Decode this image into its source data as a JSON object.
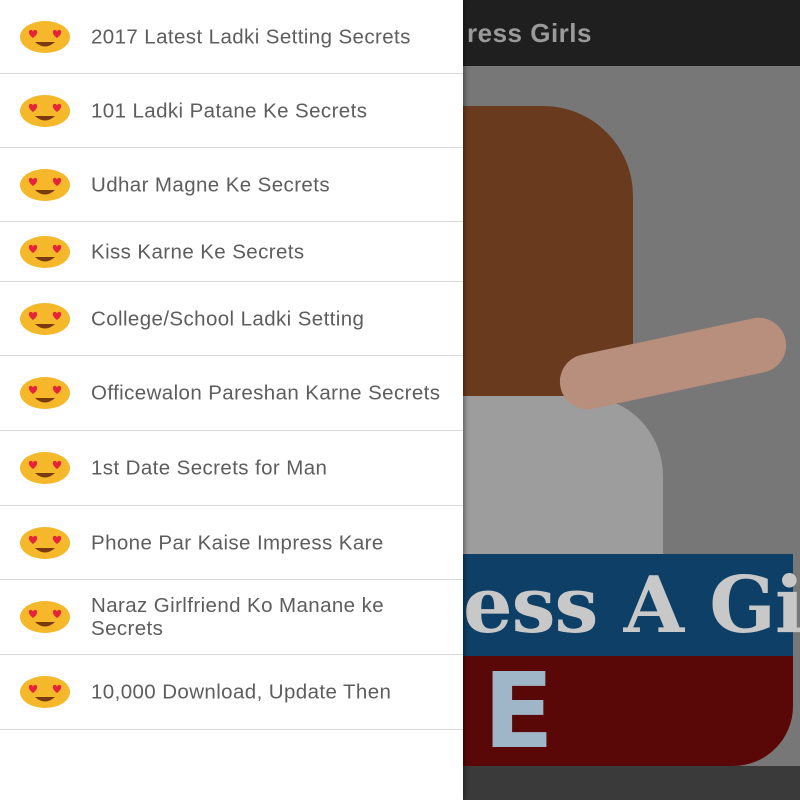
{
  "app_bar": {
    "title": "ress Girls"
  },
  "banner": {
    "text": "ess A Girl",
    "sub_letter": "E"
  },
  "drawer": {
    "items": [
      {
        "label": "2017 Latest Ladki Setting Secrets",
        "icon": "heart-eyes-emoji-icon"
      },
      {
        "label": "101 Ladki Patane Ke Secrets",
        "icon": "heart-eyes-emoji-icon"
      },
      {
        "label": "Udhar Magne Ke Secrets",
        "icon": "heart-eyes-emoji-icon"
      },
      {
        "label": "Kiss Karne Ke Secrets",
        "icon": "heart-eyes-emoji-icon"
      },
      {
        "label": "College/School Ladki Setting",
        "icon": "heart-eyes-emoji-icon"
      },
      {
        "label": "Officewalon Pareshan Karne Secrets",
        "icon": "heart-eyes-emoji-icon"
      },
      {
        "label": "1st Date Secrets for Man",
        "icon": "heart-eyes-emoji-icon"
      },
      {
        "label": "Phone Par Kaise Impress Kare",
        "icon": "heart-eyes-emoji-icon"
      },
      {
        "label": "Naraz Girlfriend Ko Manane ke Secrets",
        "icon": "heart-eyes-emoji-icon"
      },
      {
        "label": "10,000 Download, Update Then",
        "icon": "heart-eyes-emoji-icon"
      }
    ]
  },
  "colors": {
    "emoji_face": "#f5b82a",
    "emoji_heart": "#e5243b",
    "drawer_text": "#5d5d5d",
    "app_bar": "#1f1f1f"
  }
}
